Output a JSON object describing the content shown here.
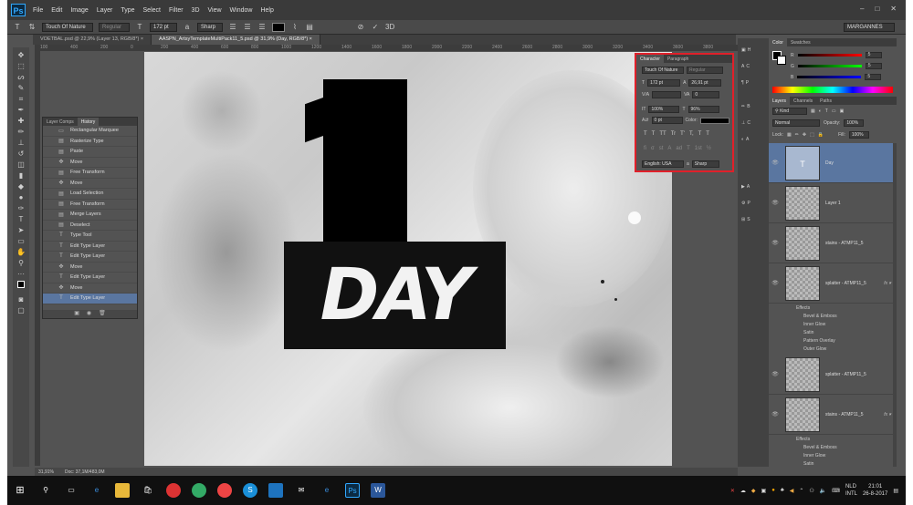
{
  "app": {
    "logo": "Ps",
    "menu": [
      "File",
      "Edit",
      "Image",
      "Layer",
      "Type",
      "Select",
      "Filter",
      "3D",
      "View",
      "Window",
      "Help"
    ],
    "window_controls": [
      "–",
      "□",
      "✕"
    ]
  },
  "options_bar": {
    "font_family": "Touch Of Nature",
    "font_style": "Regular",
    "font_size": "172 pt",
    "antialias": "Sharp",
    "workspace": "MARGANNES"
  },
  "tabs": [
    {
      "label": "VOETBAL.psd @ 22,9% (Layer 13, RGB/8*) ×",
      "active": false
    },
    {
      "label": "AASPN_ArtsyTemplateMultiPack11_5.psd @ 31,9% (Day, RGB/8*) ×",
      "active": true
    }
  ],
  "ruler_marks": [
    "100",
    "400",
    "200",
    "0",
    "200",
    "400",
    "600",
    "800",
    "1000",
    "1200",
    "1400",
    "1600",
    "1800",
    "2000",
    "2200",
    "2400",
    "2600",
    "2800",
    "3000",
    "3200",
    "3400",
    "3600",
    "3800"
  ],
  "history": {
    "tabs": [
      "Layer Comps",
      "History"
    ],
    "items": [
      {
        "label": "Rectangular Marquee",
        "icon": "▭"
      },
      {
        "label": "Rasterize Type",
        "icon": "▤"
      },
      {
        "label": "Paste",
        "icon": "▤"
      },
      {
        "label": "Move",
        "icon": "✥"
      },
      {
        "label": "Free Transform",
        "icon": "▤"
      },
      {
        "label": "Move",
        "icon": "✥"
      },
      {
        "label": "Load Selection",
        "icon": "▤"
      },
      {
        "label": "Free Transform",
        "icon": "▤"
      },
      {
        "label": "Merge Layers",
        "icon": "▤"
      },
      {
        "label": "Deselect",
        "icon": "▤"
      },
      {
        "label": "Type Tool",
        "icon": "T"
      },
      {
        "label": "Edit Type Layer",
        "icon": "T"
      },
      {
        "label": "Edit Type Layer",
        "icon": "T"
      },
      {
        "label": "Move",
        "icon": "✥"
      },
      {
        "label": "Edit Type Layer",
        "icon": "T"
      },
      {
        "label": "Move",
        "icon": "✥"
      },
      {
        "label": "Edit Type Layer",
        "icon": "T"
      }
    ]
  },
  "character_panel": {
    "tabs": [
      "Character",
      "Paragraph"
    ],
    "font_family": "Touch Of Nature",
    "font_style": "Regular",
    "size": "172 pt",
    "leading": "26,91 pt",
    "tracking": "0",
    "vertical_scale": "100%",
    "horizontal_scale": "96%",
    "baseline": "0 pt",
    "color_label": "Color:",
    "glyphs_row1": [
      "T",
      "T",
      "TT",
      "Tr",
      "T'",
      "T,",
      "T",
      "T"
    ],
    "glyphs_row2": [
      "fi",
      "σ",
      "st",
      "A",
      "ad",
      "T",
      "1st",
      "½"
    ],
    "language": "English: USA",
    "antialias": "Sharp"
  },
  "canvas_art": {
    "number": "1",
    "word": "DAY"
  },
  "color_panel": {
    "tabs": [
      "Color",
      "Swatches"
    ],
    "r_label": "R",
    "r_value": "5",
    "g_label": "G",
    "g_value": "5",
    "b_label": "B",
    "b_value": "5"
  },
  "layers_panel": {
    "tabs": [
      "Layers",
      "Channels",
      "Paths"
    ],
    "kind": "Kind",
    "blend": "Normal",
    "opacity_label": "Opacity:",
    "opacity": "100%",
    "lock_label": "Lock:",
    "fill_label": "Fill:",
    "fill": "100%",
    "layers": [
      {
        "name": "Day",
        "fx": false,
        "selected": true
      },
      {
        "name": "Layer 1",
        "fx": false,
        "selected": false
      },
      {
        "name": "stains - ATMP11_5",
        "fx": false,
        "selected": false
      },
      {
        "name": "splatter - ATMP11_5",
        "fx": true,
        "selected": false
      },
      {
        "name": "splatter - ATMP11_5",
        "fx": false,
        "selected": false
      },
      {
        "name": "stains - ATMP11_5",
        "fx": true,
        "selected": false
      }
    ],
    "effects_a": [
      "Effects",
      "Bevel & Emboss",
      "Inner Glow",
      "Satin",
      "Pattern Overlay",
      "Outer Glow"
    ],
    "effects_b": [
      "Effects",
      "Bevel & Emboss",
      "Inner Glow",
      "Satin"
    ]
  },
  "status": {
    "zoom": "31,91%",
    "doc": "Doc: 37,1M/483,0M"
  },
  "taskbar": {
    "lang": "NLD",
    "layout": "INTL",
    "time": "21:01",
    "date": "26-8-2017"
  }
}
